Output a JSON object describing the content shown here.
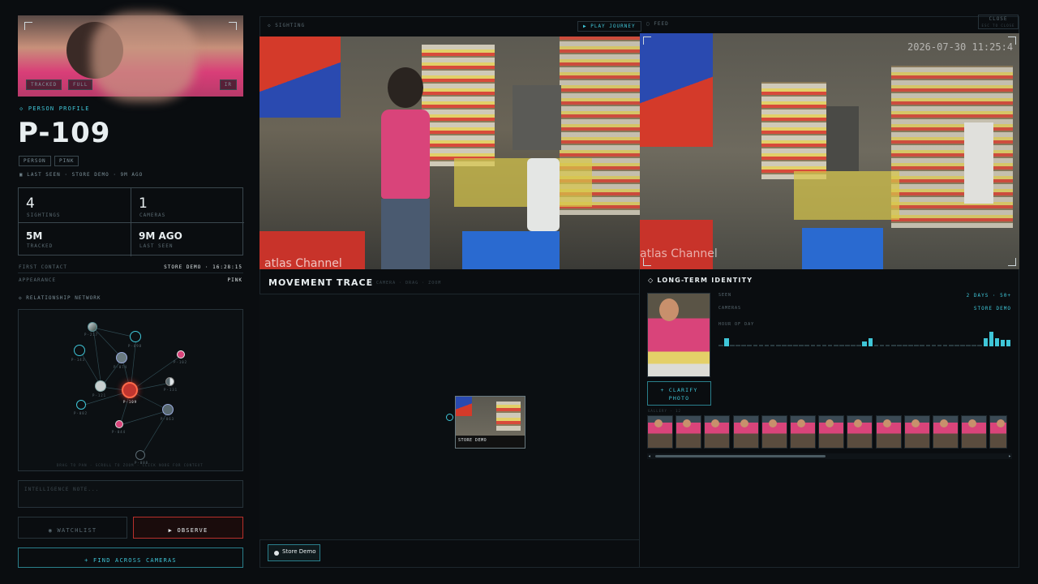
{
  "profile": {
    "section_label": "PERSON PROFILE",
    "id": "P-109",
    "tags": [
      "PERSON",
      "PINK"
    ],
    "last_seen": "LAST SEEN · STORE DEMO · 9M AGO",
    "crop_buttons": [
      "TRACKED",
      "FULL",
      "IR"
    ],
    "stats": [
      {
        "value": "4",
        "label": "SIGHTINGS"
      },
      {
        "value": "1",
        "label": "CAMERAS"
      },
      {
        "value": "5M",
        "label": "TRACKED"
      },
      {
        "value": "9M AGO",
        "label": "LAST SEEN"
      }
    ],
    "first_contact_label": "FIRST CONTACT",
    "first_contact_value": "STORE DEMO · 16:28:15",
    "appearance_label": "APPEARANCE",
    "appearance_value": "PINK"
  },
  "network": {
    "label": "RELATIONSHIP NETWORK",
    "hint": "DRAG TO PAN · SCROLL TO ZOOM · CLICK NODE FOR CONTEXT",
    "nodes": [
      "P-217",
      "P-098",
      "P-143",
      "P-074",
      "P-102",
      "P-121",
      "P-131",
      "P-109",
      "P-082",
      "P-063",
      "P-044",
      "P-088",
      "P-029"
    ]
  },
  "intel": {
    "placeholder": "INTELLIGENCE NOTE..."
  },
  "actions": {
    "watchlist": "WATCHLIST",
    "observe": "OBSERVE",
    "find": "+ FIND ACROSS CAMERAS"
  },
  "sighting": {
    "label": "SIGHTING",
    "play": "▶ PLAY JOURNEY",
    "feed_label": "FEED",
    "close": "CLOSE",
    "close_sub": "ESC TO CLOSE",
    "timestamp": "2026-07-30 11:25:4",
    "watermark": "atlas Channel"
  },
  "movement": {
    "title": "MOVEMENT TRACE",
    "subtitle": "1 CAMERA · DRAG · ZOOM",
    "node_label": "STORE DEMO",
    "legend": "Store Demo"
  },
  "identity": {
    "title": "LONG-TERM IDENTITY",
    "seen_label": "SEEN",
    "seen_value": "2 DAYS · 50+",
    "cameras_label": "CAMERAS",
    "cameras_value": "STORE DEMO",
    "hour_label": "HOUR OF DAY",
    "clarify": "+ CLARIFY PHOTO",
    "gallery_label": "GALLERY · 12",
    "hour_activity": [
      0.08,
      0.55,
      0.08,
      0.08,
      0.08,
      0.08,
      0.08,
      0.08,
      0.08,
      0.08,
      0.08,
      0.08,
      0.08,
      0.08,
      0.08,
      0.08,
      0.08,
      0.08,
      0.08,
      0.08,
      0.08,
      0.08,
      0.08,
      0.08,
      0.08,
      0.35,
      0.55,
      0.08,
      0.08,
      0.08,
      0.08,
      0.08,
      0.08,
      0.08,
      0.08,
      0.08,
      0.08,
      0.08,
      0.08,
      0.08,
      0.08,
      0.08,
      0.08,
      0.08,
      0.08,
      0.08,
      0.55,
      1.0,
      0.55,
      0.45,
      0.45
    ]
  },
  "colors": {
    "accent": "#3fc6d8",
    "danger": "#b8302c",
    "bg": "#0a0d10"
  }
}
